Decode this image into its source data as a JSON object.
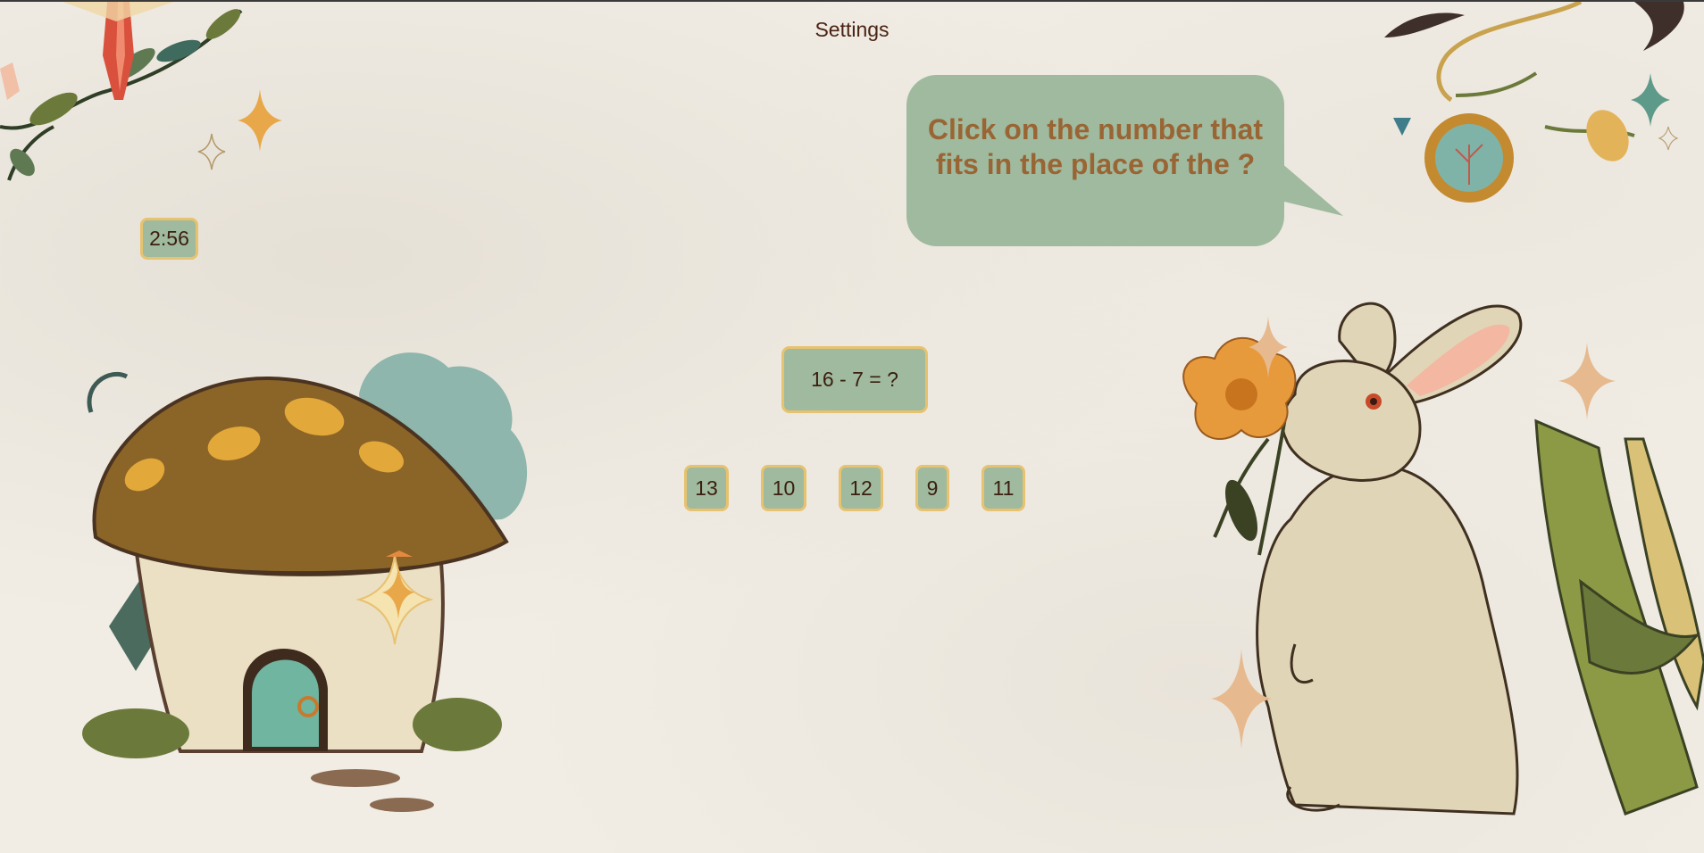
{
  "header": {
    "settings_label": "Settings"
  },
  "timer": {
    "value": "2:56"
  },
  "instruction": {
    "text": "Click on the number that fits in the place of the ?"
  },
  "question": {
    "equation": "16 - 7 = ?"
  },
  "answers": [
    "13",
    "10",
    "12",
    "9",
    "11"
  ],
  "colors": {
    "panel": "#9fba9e",
    "border": "#e7c26f",
    "instruction_text": "#9a6534",
    "text": "#3b1e10",
    "background": "#f1ede5"
  },
  "illustrations": [
    "mushroom-house-icon",
    "rabbit-icon",
    "vine-corner-icon",
    "lantern-icon",
    "sparkle-icon",
    "flower-icon"
  ]
}
